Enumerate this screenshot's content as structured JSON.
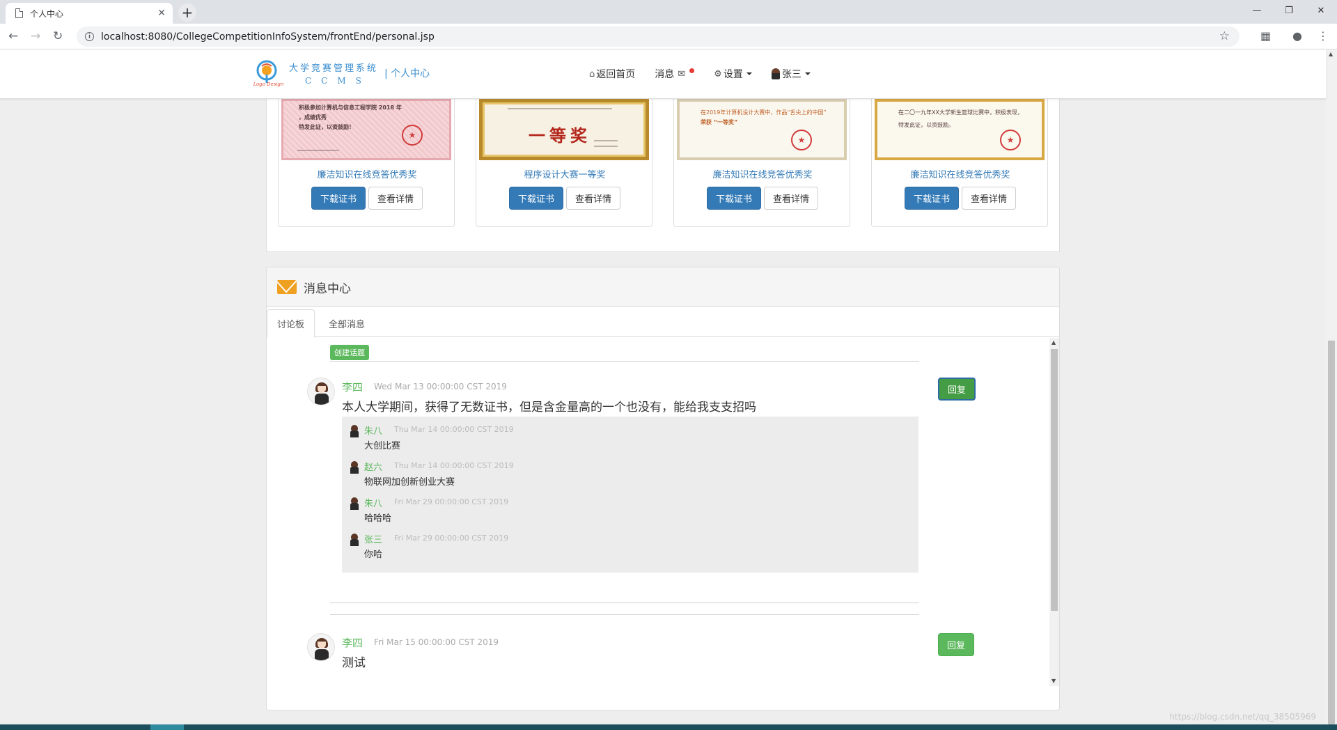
{
  "browser": {
    "tab_title": "个人中心",
    "url": "localhost:8080/CollegeCompetitionInfoSystem/frontEnd/personal.jsp",
    "tab_close_glyph": "✕",
    "new_tab_glyph": "+",
    "minimize_glyph": "—",
    "maximize_glyph": "❐",
    "close_glyph": "✕"
  },
  "site": {
    "logo_caption": "Logo Design",
    "logo_name": "大学竞赛管理系统",
    "logo_abbr": "CCMS",
    "page_label": "| 个人中心",
    "nav": {
      "home": "返回首页",
      "messages": "消息",
      "settings": "设置",
      "user": "张三"
    }
  },
  "certificates": [
    {
      "name": "廉洁知识在线竞答优秀奖",
      "download": "下载证书",
      "detail": "查看详情",
      "text1": "积极参加计算机与信息工程学院 2018 年",
      "text2": "，成绩优秀",
      "text3": "特发此证，以资鼓励！"
    },
    {
      "name": "程序设计大赛一等奖",
      "download": "下载证书",
      "detail": "查看详情",
      "award": "一等奖"
    },
    {
      "name": "廉洁知识在线竞答优秀奖",
      "download": "下载证书",
      "detail": "查看详情",
      "text1": "在2019年计算机设计大赛中，作品“舌尖上的中国”",
      "text2": "荣获 “一等奖”"
    },
    {
      "name": "廉洁知识在线竞答优秀奖",
      "download": "下载证书",
      "detail": "查看详情",
      "text1": "在二〇一九年XX大学新生篮球比赛中，积极表现，",
      "text2": "特发此证，以资鼓励。"
    }
  ],
  "messages": {
    "title": "消息中心",
    "tabs": [
      "讨论板",
      "全部消息"
    ],
    "create_topic": "创建话题",
    "posts": [
      {
        "author": "李四",
        "date": "Wed Mar 13 00:00:00 CST 2019",
        "content": "本人大学期间，获得了无数证书，但是含金量高的一个也没有，能给我支支招吗",
        "reply_label": "回复",
        "replies": [
          {
            "author": "朱八",
            "date": "Thu Mar 14 00:00:00 CST 2019",
            "content": "大创比赛"
          },
          {
            "author": "赵六",
            "date": "Thu Mar 14 00:00:00 CST 2019",
            "content": "物联网加创新创业大赛"
          },
          {
            "author": "朱八",
            "date": "Fri Mar 29 00:00:00 CST 2019",
            "content": "哈哈哈"
          },
          {
            "author": "张三",
            "date": "Fri Mar 29 00:00:00 CST 2019",
            "content": "你哈"
          }
        ]
      },
      {
        "author": "李四",
        "date": "Fri Mar 15 00:00:00 CST 2019",
        "content": "测试",
        "reply_label": "回复"
      }
    ]
  },
  "watermark": "https://blog.csdn.net/qq_38505969",
  "colors": {
    "primary": "#337ab7",
    "success": "#5cb85c",
    "link": "#337ab7",
    "accent_orange": "#f0a020"
  }
}
